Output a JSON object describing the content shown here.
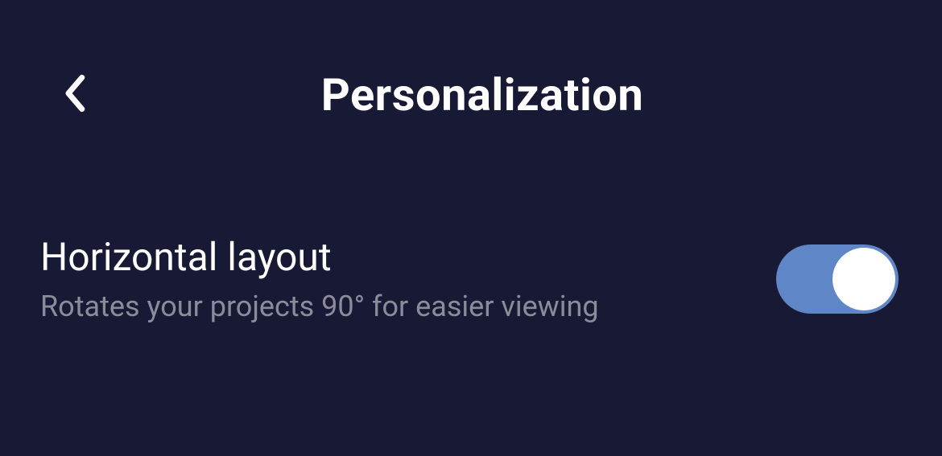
{
  "header": {
    "title": "Personalization"
  },
  "settings": {
    "horizontal_layout": {
      "title": "Horizontal layout",
      "description": "Rotates your projects 90° for easier viewing",
      "enabled": true
    }
  }
}
